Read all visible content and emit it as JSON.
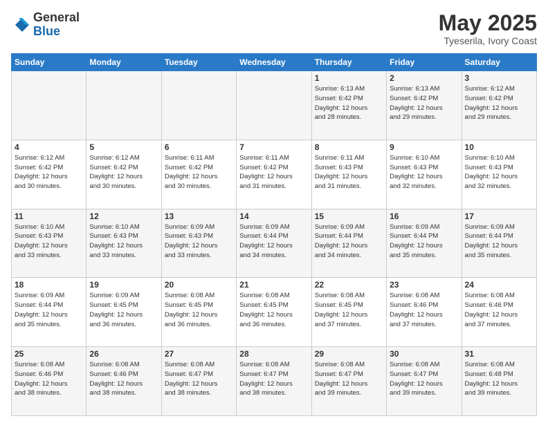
{
  "header": {
    "logo": {
      "general": "General",
      "blue": "Blue"
    },
    "title": "May 2025",
    "subtitle": "Tyeserila, Ivory Coast"
  },
  "calendar": {
    "days_of_week": [
      "Sunday",
      "Monday",
      "Tuesday",
      "Wednesday",
      "Thursday",
      "Friday",
      "Saturday"
    ],
    "weeks": [
      [
        {
          "day": "",
          "info": ""
        },
        {
          "day": "",
          "info": ""
        },
        {
          "day": "",
          "info": ""
        },
        {
          "day": "",
          "info": ""
        },
        {
          "day": "1",
          "info": "Sunrise: 6:13 AM\nSunset: 6:42 PM\nDaylight: 12 hours\nand 28 minutes."
        },
        {
          "day": "2",
          "info": "Sunrise: 6:13 AM\nSunset: 6:42 PM\nDaylight: 12 hours\nand 29 minutes."
        },
        {
          "day": "3",
          "info": "Sunrise: 6:12 AM\nSunset: 6:42 PM\nDaylight: 12 hours\nand 29 minutes."
        }
      ],
      [
        {
          "day": "4",
          "info": "Sunrise: 6:12 AM\nSunset: 6:42 PM\nDaylight: 12 hours\nand 30 minutes."
        },
        {
          "day": "5",
          "info": "Sunrise: 6:12 AM\nSunset: 6:42 PM\nDaylight: 12 hours\nand 30 minutes."
        },
        {
          "day": "6",
          "info": "Sunrise: 6:11 AM\nSunset: 6:42 PM\nDaylight: 12 hours\nand 30 minutes."
        },
        {
          "day": "7",
          "info": "Sunrise: 6:11 AM\nSunset: 6:42 PM\nDaylight: 12 hours\nand 31 minutes."
        },
        {
          "day": "8",
          "info": "Sunrise: 6:11 AM\nSunset: 6:43 PM\nDaylight: 12 hours\nand 31 minutes."
        },
        {
          "day": "9",
          "info": "Sunrise: 6:10 AM\nSunset: 6:43 PM\nDaylight: 12 hours\nand 32 minutes."
        },
        {
          "day": "10",
          "info": "Sunrise: 6:10 AM\nSunset: 6:43 PM\nDaylight: 12 hours\nand 32 minutes."
        }
      ],
      [
        {
          "day": "11",
          "info": "Sunrise: 6:10 AM\nSunset: 6:43 PM\nDaylight: 12 hours\nand 33 minutes."
        },
        {
          "day": "12",
          "info": "Sunrise: 6:10 AM\nSunset: 6:43 PM\nDaylight: 12 hours\nand 33 minutes."
        },
        {
          "day": "13",
          "info": "Sunrise: 6:09 AM\nSunset: 6:43 PM\nDaylight: 12 hours\nand 33 minutes."
        },
        {
          "day": "14",
          "info": "Sunrise: 6:09 AM\nSunset: 6:44 PM\nDaylight: 12 hours\nand 34 minutes."
        },
        {
          "day": "15",
          "info": "Sunrise: 6:09 AM\nSunset: 6:44 PM\nDaylight: 12 hours\nand 34 minutes."
        },
        {
          "day": "16",
          "info": "Sunrise: 6:09 AM\nSunset: 6:44 PM\nDaylight: 12 hours\nand 35 minutes."
        },
        {
          "day": "17",
          "info": "Sunrise: 6:09 AM\nSunset: 6:44 PM\nDaylight: 12 hours\nand 35 minutes."
        }
      ],
      [
        {
          "day": "18",
          "info": "Sunrise: 6:09 AM\nSunset: 6:44 PM\nDaylight: 12 hours\nand 35 minutes."
        },
        {
          "day": "19",
          "info": "Sunrise: 6:09 AM\nSunset: 6:45 PM\nDaylight: 12 hours\nand 36 minutes."
        },
        {
          "day": "20",
          "info": "Sunrise: 6:08 AM\nSunset: 6:45 PM\nDaylight: 12 hours\nand 36 minutes."
        },
        {
          "day": "21",
          "info": "Sunrise: 6:08 AM\nSunset: 6:45 PM\nDaylight: 12 hours\nand 36 minutes."
        },
        {
          "day": "22",
          "info": "Sunrise: 6:08 AM\nSunset: 6:45 PM\nDaylight: 12 hours\nand 37 minutes."
        },
        {
          "day": "23",
          "info": "Sunrise: 6:08 AM\nSunset: 6:46 PM\nDaylight: 12 hours\nand 37 minutes."
        },
        {
          "day": "24",
          "info": "Sunrise: 6:08 AM\nSunset: 6:46 PM\nDaylight: 12 hours\nand 37 minutes."
        }
      ],
      [
        {
          "day": "25",
          "info": "Sunrise: 6:08 AM\nSunset: 6:46 PM\nDaylight: 12 hours\nand 38 minutes."
        },
        {
          "day": "26",
          "info": "Sunrise: 6:08 AM\nSunset: 6:46 PM\nDaylight: 12 hours\nand 38 minutes."
        },
        {
          "day": "27",
          "info": "Sunrise: 6:08 AM\nSunset: 6:47 PM\nDaylight: 12 hours\nand 38 minutes."
        },
        {
          "day": "28",
          "info": "Sunrise: 6:08 AM\nSunset: 6:47 PM\nDaylight: 12 hours\nand 38 minutes."
        },
        {
          "day": "29",
          "info": "Sunrise: 6:08 AM\nSunset: 6:47 PM\nDaylight: 12 hours\nand 39 minutes."
        },
        {
          "day": "30",
          "info": "Sunrise: 6:08 AM\nSunset: 6:47 PM\nDaylight: 12 hours\nand 39 minutes."
        },
        {
          "day": "31",
          "info": "Sunrise: 6:08 AM\nSunset: 6:48 PM\nDaylight: 12 hours\nand 39 minutes."
        }
      ]
    ]
  }
}
